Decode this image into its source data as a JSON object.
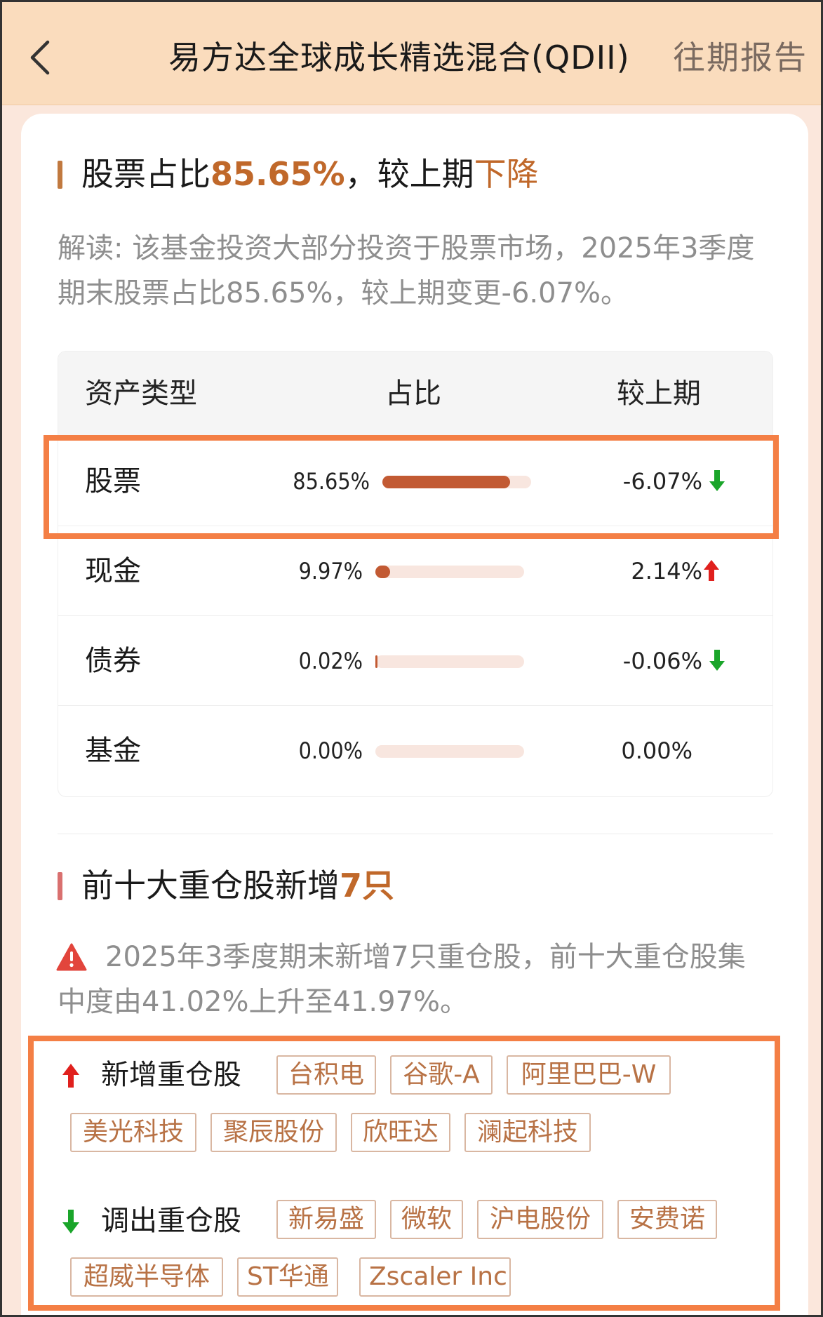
{
  "header": {
    "title": "易方达全球成长精选混合(QDII)",
    "link": "往期报告"
  },
  "section1": {
    "title_prefix": "股票占比",
    "title_value": "85.65%",
    "title_mid": "，较上期",
    "title_trend": "下降",
    "description": "解读: 该基金投资大部分投资于股票市场，2025年3季度期末股票占比85.65%，较上期变更-6.07%。"
  },
  "table": {
    "headers": [
      "资产类型",
      "占比",
      "较上期"
    ],
    "rows": [
      {
        "type": "股票",
        "pct": "85.65%",
        "fraction": 0.8565,
        "change": "-6.07%",
        "trend": "down"
      },
      {
        "type": "现金",
        "pct": "9.97%",
        "fraction": 0.0997,
        "change": "2.14%",
        "trend": "up"
      },
      {
        "type": "债券",
        "pct": "0.02%",
        "fraction": 0.0002,
        "change": "-0.06%",
        "trend": "down"
      },
      {
        "type": "基金",
        "pct": "0.00%",
        "fraction": 0.0,
        "change": "0.00%",
        "trend": "none"
      }
    ]
  },
  "section2": {
    "title_prefix": "前十大重仓股新增",
    "title_value": "7只",
    "description": "2025年3季度期末新增7只重仓股，前十大重仓股集中度由41.02%上升至41.97%。"
  },
  "holdings": {
    "added_label": "新增重仓股",
    "added": [
      "台积电",
      "谷歌-A",
      "阿里巴巴-W",
      "美光科技",
      "聚辰股份",
      "欣旺达",
      "澜起科技"
    ],
    "removed_label": "调出重仓股",
    "removed": [
      "新易盛",
      "微软",
      "沪电股份",
      "安费诺",
      "超威半导体",
      "ST华通",
      "Zscaler Inc"
    ]
  },
  "colors": {
    "accent": "#c0682a",
    "bar": "#c25a33",
    "up": "#e0201d",
    "down": "#1aa52a",
    "highlight": "#f47f45"
  }
}
